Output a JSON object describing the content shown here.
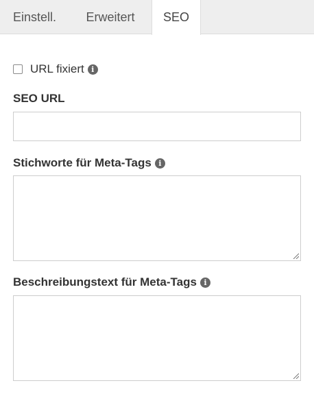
{
  "tabs": [
    {
      "label": "Einstell.",
      "active": false
    },
    {
      "label": "Erweitert",
      "active": false
    },
    {
      "label": "SEO",
      "active": true
    }
  ],
  "url_fix": {
    "label": "URL fixiert",
    "checked": false,
    "info_icon": "info-circle-icon"
  },
  "seo_url": {
    "label": "SEO URL",
    "value": ""
  },
  "keywords": {
    "label": "Stichworte für Meta-Tags",
    "value": "",
    "info_icon": "info-circle-icon"
  },
  "description": {
    "label": "Beschreibungstext für Meta-Tags",
    "value": "",
    "info_icon": "info-circle-icon"
  },
  "colors": {
    "tab_bar_bg": "#eeeeee",
    "border": "#cccccc",
    "text": "#333333",
    "icon": "#666666"
  }
}
